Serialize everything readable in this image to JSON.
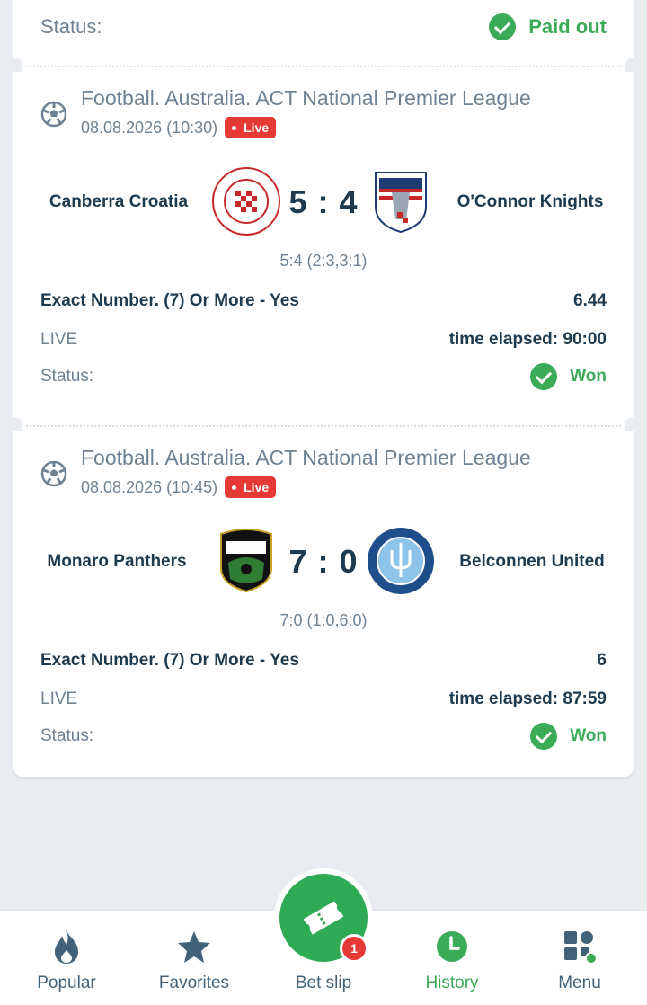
{
  "top": {
    "status_label": "Status:",
    "status_value": "Paid out"
  },
  "bets": [
    {
      "league": "Football. Australia. ACT National Premier League",
      "datetime": "08.08.2026 (10:30)",
      "live_badge": "Live",
      "home": "Canberra Croatia",
      "away": "O'Connor Knights",
      "score": "5 : 4",
      "subscore": "5:4 (2:3,3:1)",
      "market": "Exact Number. (7) Or More - Yes",
      "odds": "6.44",
      "phase": "LIVE",
      "time": "time elapsed: 90:00",
      "status_label": "Status:",
      "status_value": "Won"
    },
    {
      "league": "Football. Australia. ACT National Premier League",
      "datetime": "08.08.2026 (10:45)",
      "live_badge": "Live",
      "home": "Monaro Panthers",
      "away": "Belconnen United",
      "score": "7 : 0",
      "subscore": "7:0 (1:0,6:0)",
      "market": "Exact Number. (7) Or More - Yes",
      "odds": "6",
      "phase": "LIVE",
      "time": "time elapsed: 87:59",
      "status_label": "Status:",
      "status_value": "Won"
    }
  ],
  "nav": {
    "popular": "Popular",
    "favorites": "Favorites",
    "betslip": "Bet slip",
    "betslip_count": "1",
    "history": "History",
    "menu": "Menu"
  },
  "colors": {
    "accent": "#3bab58",
    "live": "#e53935",
    "text": "#1d3a4f",
    "muted": "#6e8293"
  }
}
